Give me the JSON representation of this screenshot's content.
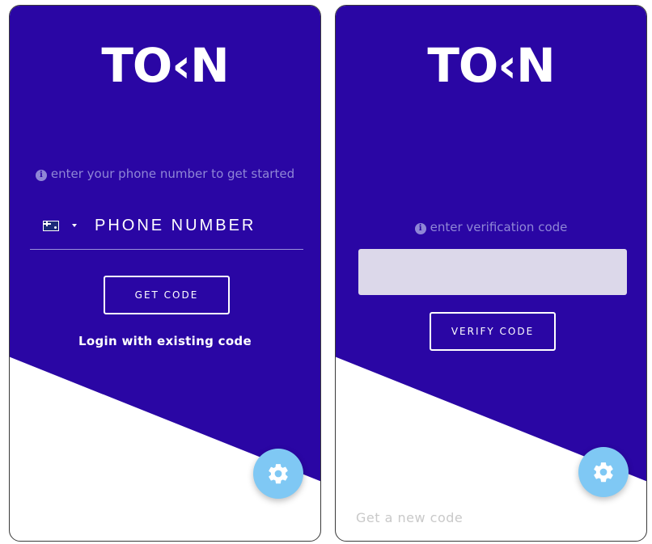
{
  "colors": {
    "brand": "#2a06a4",
    "accent": "#7fc8f4",
    "hint": "#8f86d6",
    "input_bg": "#dcd8ea"
  },
  "phone_screen": {
    "logo": "TO‹N",
    "hint": "enter your phone number to get started",
    "info_icon": "info-icon",
    "country_flag": "australia-flag-icon",
    "phone_placeholder": "PHONE NUMBER",
    "phone_value": "",
    "get_code_label": "GET CODE",
    "login_link": "Login with existing code",
    "settings_icon": "gear-icon"
  },
  "verify_screen": {
    "logo": "TO‹N",
    "hint": "enter verification code",
    "info_icon": "info-icon",
    "code_value": "",
    "verify_label": "VERIFY CODE",
    "new_code_link": "Get a new code",
    "settings_icon": "gear-icon"
  }
}
